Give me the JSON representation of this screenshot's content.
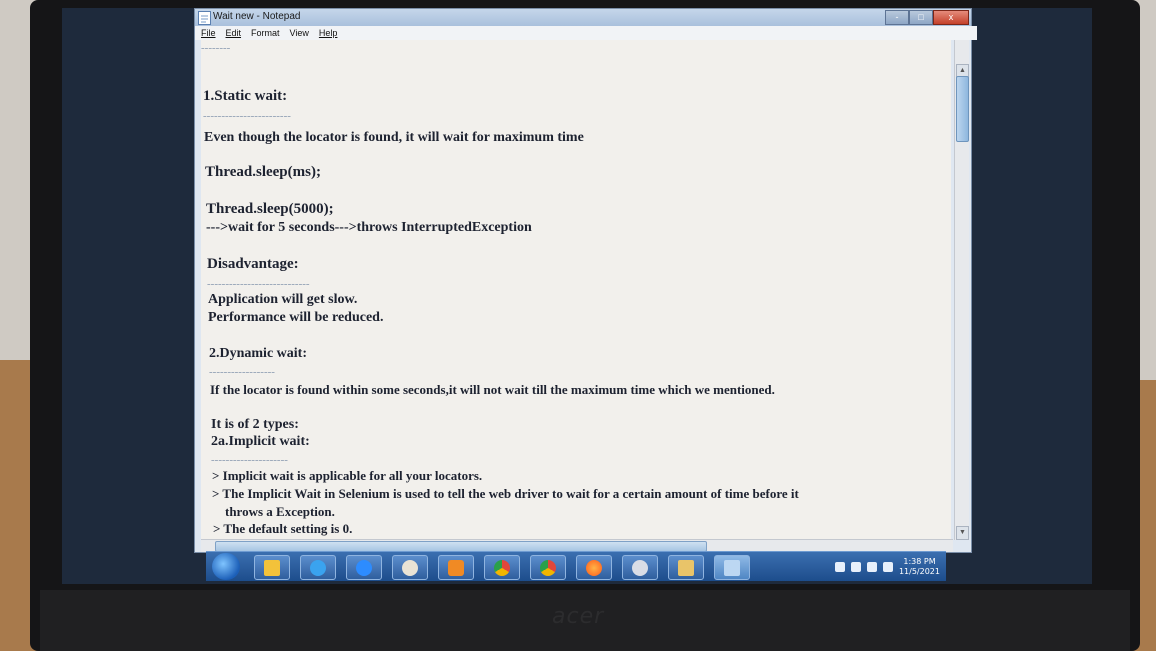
{
  "window": {
    "title": "Wait new - Notepad",
    "minimize": "-",
    "maximize": "□",
    "close": "x"
  },
  "menu": {
    "items": [
      "File",
      "Edit",
      "Format",
      "View",
      "Help"
    ]
  },
  "editor": {
    "lines": [
      "--------",
      "1.Static wait:",
      "------------------------",
      "Even though the locator is found, it will wait for maximum time",
      "Thread.sleep(ms);",
      "Thread.sleep(5000);",
      "--->wait for 5 seconds--->throws InterruptedException",
      "Disadvantage:",
      "----------------------------",
      "Application will get slow.",
      "Performance will be reduced.",
      "2.Dynamic wait:",
      "------------------",
      "If the locator is found within some seconds,it will not wait till the maximum time which we mentioned.",
      "It is of 2 types:",
      "2a.Implicit wait:",
      "---------------------",
      "> Implicit wait is applicable for all your locators.",
      "> The Implicit Wait in Selenium is used to tell the web driver to wait for a certain amount of time before it",
      "throws a Exception.",
      "> The default setting is 0."
    ]
  },
  "taskbar": {
    "icons": [
      {
        "name": "explorer-icon",
        "color": "#f3c23a"
      },
      {
        "name": "ie-icon",
        "color": "#3aa3ef"
      },
      {
        "name": "zoom-icon",
        "color": "#2d8cff"
      },
      {
        "name": "paint-icon",
        "color": "#e9e3d5"
      },
      {
        "name": "media-player-icon",
        "color": "#f08a24"
      },
      {
        "name": "chrome-icon",
        "color": "#e2473b"
      },
      {
        "name": "chrome-alt-icon",
        "color": "#f2b600"
      },
      {
        "name": "firefox-icon",
        "color": "#ff7a1a"
      },
      {
        "name": "app-icon",
        "color": "#d9dde6"
      },
      {
        "name": "photos-icon",
        "color": "#e9c469"
      },
      {
        "name": "notepad-icon",
        "color": "#bcd7f2"
      }
    ],
    "time": "1:38 PM",
    "date": "11/5/2021"
  },
  "branding": {
    "laptop_logo": "acer"
  }
}
